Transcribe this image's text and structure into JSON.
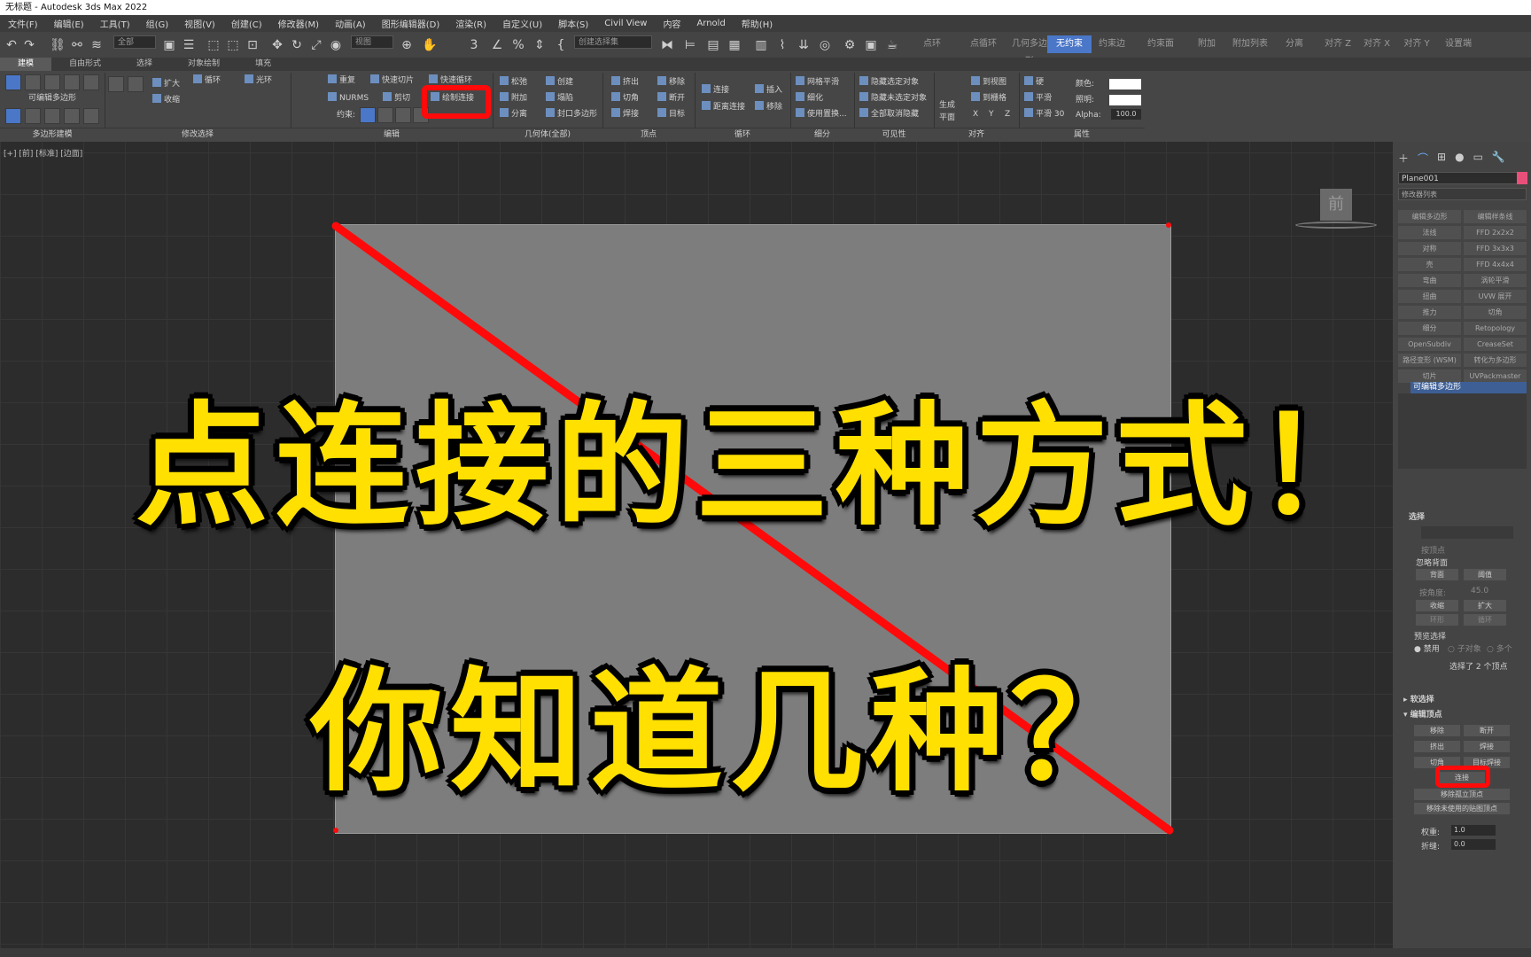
{
  "window": {
    "title": "无标题 - Autodesk 3ds Max 2022"
  },
  "menu": [
    "文件(F)",
    "编辑(E)",
    "工具(T)",
    "组(G)",
    "视图(V)",
    "创建(C)",
    "修改器(M)",
    "动画(A)",
    "图形编辑器(D)",
    "渲染(R)",
    "自定义(U)",
    "脚本(S)",
    "Civil View",
    "内容",
    "Arnold",
    "帮助(H)"
  ],
  "toolbar": {
    "filter_dropdown": "全部",
    "view_dropdown": "视图",
    "selection_set": "创建选择集",
    "context_tabs": [
      "点环",
      "点循环",
      "几何多边形",
      "无约束",
      "约束边",
      "约束面",
      "附加",
      "附加列表",
      "分离",
      "对齐 Z",
      "对齐 X",
      "对齐 Y",
      "设置端"
    ],
    "active_context": "无约束"
  },
  "ribbon_tabs": [
    "建模",
    "自由形式",
    "选择",
    "对象绘制",
    "填充"
  ],
  "ribbon": {
    "polygon_modeling": {
      "label": "多边形建模",
      "items": [
        "可编辑多边形"
      ]
    },
    "modify_selection": {
      "label": "修改选择",
      "items": [
        "扩大",
        "收缩",
        "循环",
        "光环"
      ]
    },
    "edit": {
      "label": "编辑",
      "items": [
        "重复",
        "快速切片",
        "快速循环",
        "NURMS",
        "剪切",
        "绘制连接",
        "约束:"
      ]
    },
    "geometry": {
      "label": "几何体(全部)",
      "items": [
        "松弛",
        "创建",
        "附加",
        "塌陷",
        "分离",
        "封口多边形"
      ]
    },
    "vertices": {
      "label": "顶点",
      "items": [
        "挤出",
        "移除",
        "切角",
        "断开",
        "焊接",
        "目标"
      ]
    },
    "loops": {
      "label": "循环",
      "items": [
        "连接",
        "插入",
        "距离连接",
        "移除"
      ]
    },
    "subdivision": {
      "label": "细分",
      "items": [
        "网格平滑",
        "细化",
        "使用置换..."
      ]
    },
    "visibility": {
      "label": "可见性",
      "items": [
        "隐藏选定对象",
        "隐藏未选定对象",
        "全部取消隐藏"
      ]
    },
    "align": {
      "label": "对齐",
      "items": [
        "生成平面",
        "到视图",
        "到栅格",
        "X",
        "Y",
        "Z"
      ]
    },
    "smooth": {
      "items": [
        "硬",
        "平滑",
        "平滑 30"
      ]
    },
    "properties": {
      "label": "属性",
      "items": [
        "颜色:",
        "照明:",
        "Alpha:"
      ],
      "alpha_value": "100.0"
    }
  },
  "viewport": {
    "label": "[+] [前] [标准] [边面]",
    "viewcube_label": "前"
  },
  "headline": {
    "line1": "点连接的三种方式！",
    "line2": "你知道几种？",
    "color": "#ffe000"
  },
  "command_panel": {
    "object_name": "Plane001",
    "modifier_list": "修改器列表",
    "modifiers": [
      "编辑多边形",
      "编辑样条线",
      "法线",
      "FFD 2x2x2",
      "对称",
      "FFD 3x3x3",
      "壳",
      "FFD 4x4x4",
      "弯曲",
      "涡轮平滑",
      "扭曲",
      "UVW 展开",
      "推力",
      "切角",
      "细分",
      "Retopology",
      "OpenSubdiv",
      "CreaseSet",
      "路径变形 (WSM)",
      "转化为多边形",
      "切片",
      "UVPackmaster"
    ],
    "stack_item": "可编辑多边形",
    "selection": {
      "title": "选择",
      "by_vertex": "按顶点",
      "ignore_backfacing": "忽略背面",
      "shrink": "收缩",
      "grow": "扩大",
      "ring": "环形",
      "loop": "循环",
      "preview_selection": "预览选择",
      "preview_options": [
        "禁用",
        "子对象",
        "多个"
      ],
      "selected_count": "选择了 2 个顶点",
      "back": "背面",
      "threshold": "阈值",
      "by_angle": "按角度:",
      "angle_value": "45.0"
    },
    "soft_selection": "软选择",
    "edit_vertices": {
      "title": "编辑顶点",
      "buttons": [
        "移除",
        "断开",
        "挤出",
        "焊接",
        "切角",
        "目标焊接",
        "连接",
        "移除孤立顶点",
        "移除未使用的贴图顶点"
      ],
      "weight_label": "权重:",
      "weight_value": "1.0",
      "crease_label": "折缝:",
      "crease_value": "0.0"
    }
  },
  "colors": {
    "highlight": "#ff0a0a",
    "accent": "#4a77c8",
    "plane_gray": "#7d7d7d",
    "swatch": "#e8507a"
  }
}
